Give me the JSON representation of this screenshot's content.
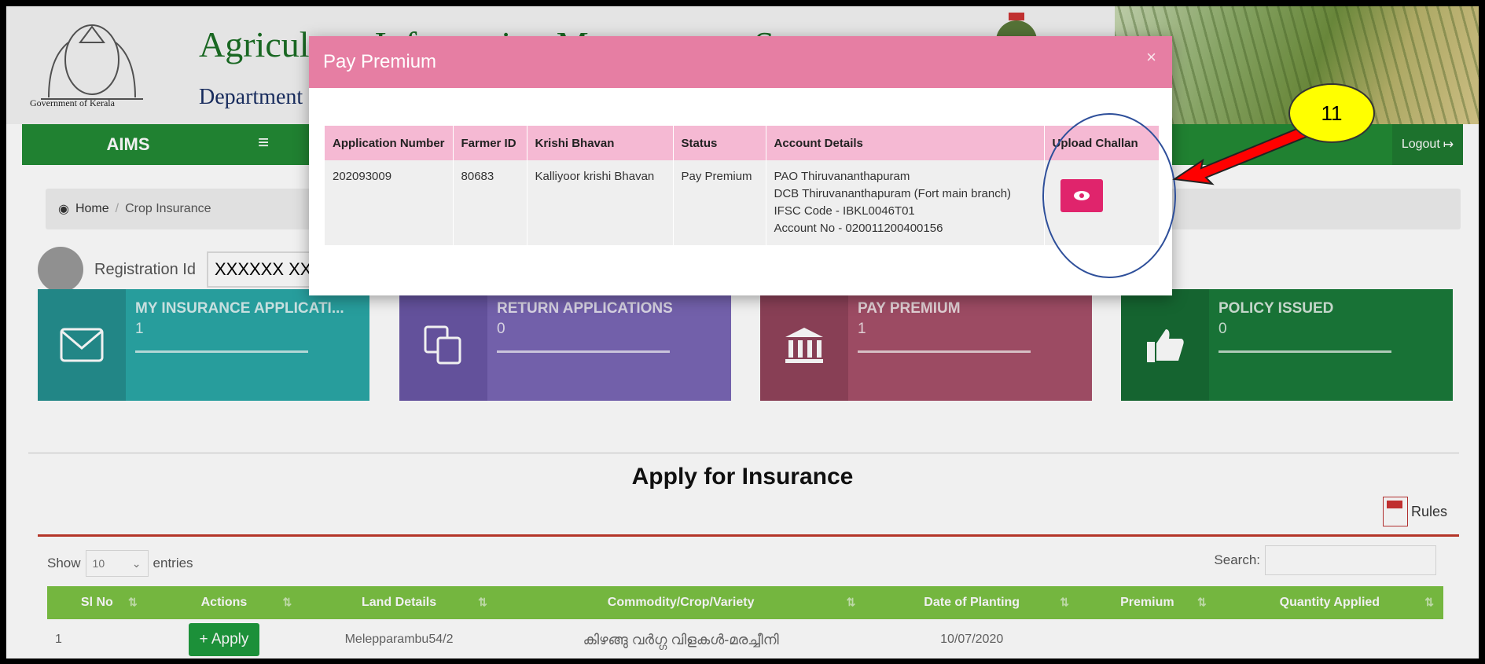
{
  "header": {
    "emblem_caption": "Government of Kerala",
    "title": "Agriculture Information Management System",
    "department": "Department"
  },
  "nav": {
    "brand": "AIMS",
    "menu_icon": "≡",
    "logout": "Logout"
  },
  "breadcrumb": {
    "home": "Home",
    "sep": "/",
    "current": "Crop Insurance"
  },
  "registration": {
    "label": "Registration Id",
    "value": "XXXXXX XX"
  },
  "cards": [
    {
      "title": "MY INSURANCE APPLICATI...",
      "count": "1",
      "icon": "envelope-icon"
    },
    {
      "title": "RETURN APPLICATIONS",
      "count": "0",
      "icon": "copy-icon"
    },
    {
      "title": "PAY PREMIUM",
      "count": "1",
      "icon": "bank-icon"
    },
    {
      "title": "POLICY ISSUED",
      "count": "0",
      "icon": "thumbs-up-icon"
    }
  ],
  "main": {
    "title": "Apply for Insurance",
    "rules": "Rules",
    "show": "Show",
    "entries_value": "10",
    "entries": "entries",
    "search": "Search:"
  },
  "table": {
    "headers": [
      "Sl No",
      "Actions",
      "Land Details",
      "Commodity/Crop/Variety",
      "Date of Planting",
      "Premium",
      "Quantity Applied"
    ],
    "row": {
      "sl": "1",
      "action": "+ Apply",
      "land": "Melepparambu54/2",
      "crop": "കിഴങ്ങു വർഗ്ഗ വിളകൾ-മരച്ചീനി",
      "date": "10/07/2020",
      "premium": "",
      "qty": ""
    }
  },
  "modal": {
    "title": "Pay Premium",
    "close": "×",
    "headers": [
      "Application Number",
      "Farmer ID",
      "Krishi Bhavan",
      "Status",
      "Account Details",
      "Upload Challan"
    ],
    "row": {
      "app_no": "202093009",
      "farmer_id": "80683",
      "krishi_bhavan": "Kalliyoor krishi Bhavan",
      "status": "Pay Premium",
      "account": [
        "PAO Thiruvananthapuram",
        "DCB Thiruvananthapuram (Fort main branch)",
        "IFSC Code - IBKL0046T01",
        "Account No - 020011200400156"
      ]
    }
  },
  "annotation": {
    "step": "11",
    "colors": {
      "badge": "#ffff00",
      "arrow": "#ff0000",
      "ring": "#2e4f9a"
    }
  }
}
